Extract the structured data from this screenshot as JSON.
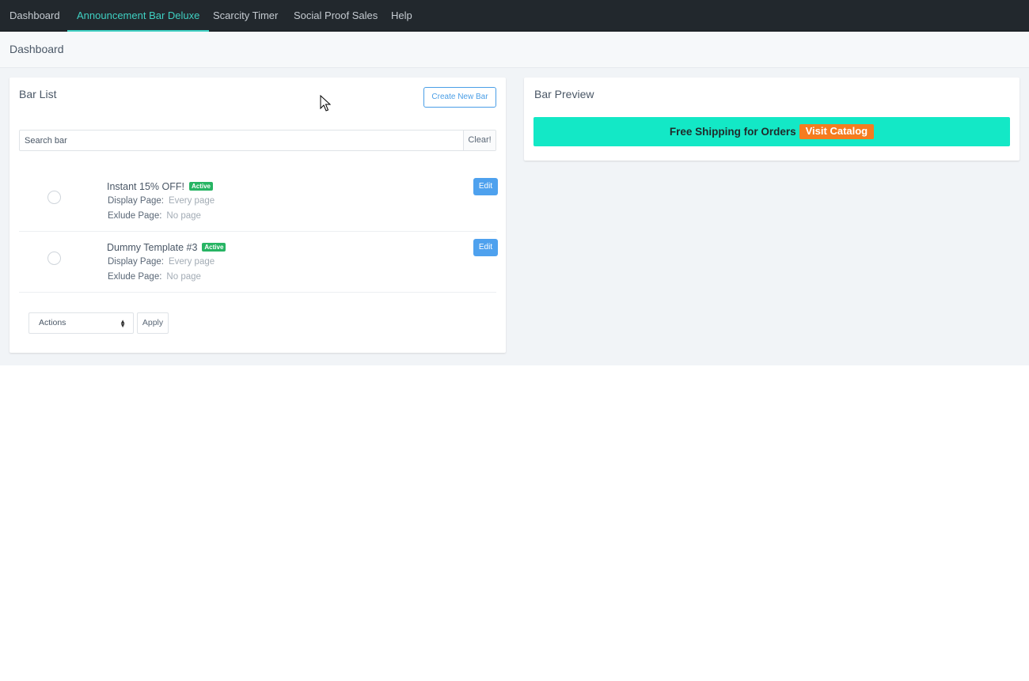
{
  "nav": {
    "items": [
      {
        "label": "Dashboard",
        "active": false
      },
      {
        "label": "Announcement Bar Deluxe",
        "active": true
      },
      {
        "label": "Scarcity Timer",
        "active": false
      },
      {
        "label": "Social Proof Sales",
        "active": false
      },
      {
        "label": "Help",
        "active": false
      }
    ]
  },
  "page": {
    "title": "Dashboard"
  },
  "bar_list": {
    "title": "Bar List",
    "create_button": "Create New Bar",
    "search_placeholder": "Search bar",
    "clear_button": "Clear!",
    "items": [
      {
        "name": "Instant 15% OFF!",
        "status": "Active",
        "display_label": "Display Page:",
        "display_value": "Every page",
        "exclude_label": "Exlude Page:",
        "exclude_value": "No page",
        "edit_label": "Edit"
      },
      {
        "name": "Dummy Template #3",
        "status": "Active",
        "display_label": "Display Page:",
        "display_value": "Every page",
        "exclude_label": "Exlude Page:",
        "exclude_value": "No page",
        "edit_label": "Edit"
      }
    ],
    "actions_select": "Actions",
    "apply_button": "Apply"
  },
  "bar_preview": {
    "title": "Bar Preview",
    "message": "Free Shipping for Orders",
    "button_label": "Visit Catalog",
    "bar_color": "#13e8c6",
    "button_color": "#f57c1f"
  },
  "colors": {
    "nav_bg": "#22282d",
    "nav_active": "#3fd0c2",
    "badge_active": "#27b463",
    "edit_button": "#4ea1ee"
  }
}
